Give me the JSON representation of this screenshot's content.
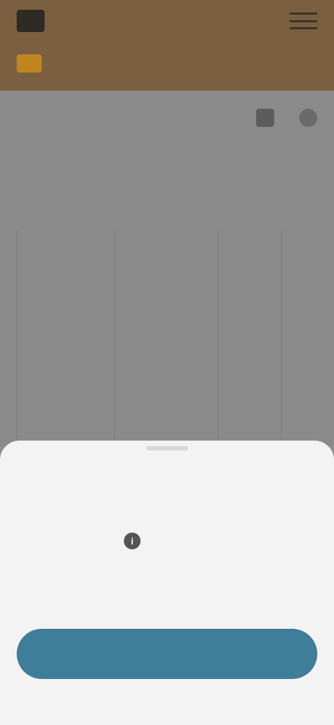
{
  "header": {
    "logo_text": "",
    "logo_glyph": "",
    "location_label": "",
    "menu_icon": "hamburger-menu-icon",
    "location_icon": "location-pin-icon",
    "colors": {
      "header_bg": "#7a6040",
      "location_accent": "#c0861d"
    }
  },
  "content": {
    "section_title": "",
    "month_label": "",
    "day_cells": [
      {
        "label": ""
      },
      {
        "label": ""
      },
      {
        "label": ""
      },
      {
        "label": ""
      },
      {
        "label": ""
      },
      {
        "label": ""
      }
    ],
    "tools": {
      "calendar_icon": "calendar-icon",
      "list_icon": "list-icon"
    }
  },
  "bottom_sheet": {
    "title": "",
    "field1_label": "",
    "field1_value": "",
    "info_icon_glyph": "i",
    "field2_label": "",
    "field2_value": "",
    "primary_button_label": "",
    "colors": {
      "sheet_bg": "#f3f3f3",
      "primary_button": "#3f7d99"
    }
  }
}
